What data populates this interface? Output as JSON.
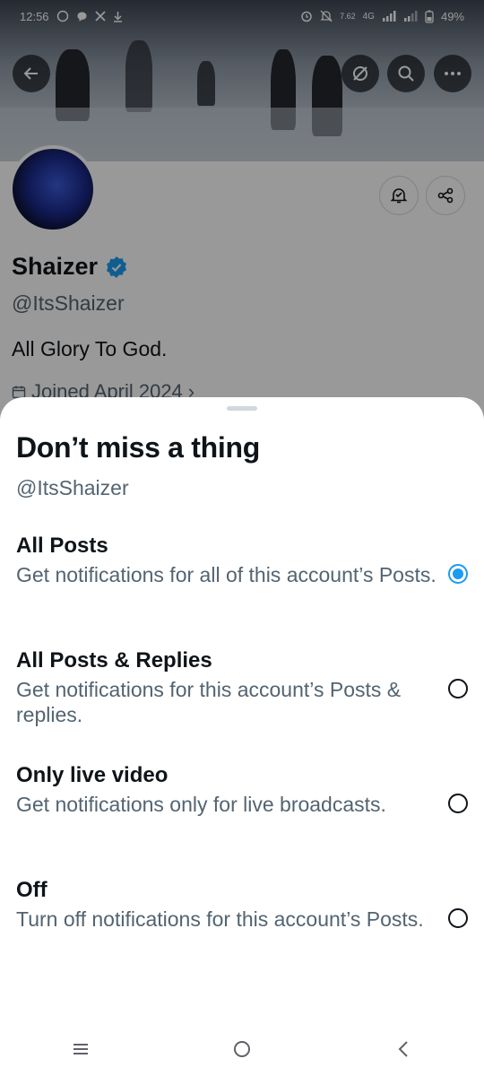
{
  "status_bar": {
    "time": "12:56",
    "left_icons": [
      "whatsapp-icon",
      "chat-icon",
      "x-icon",
      "download-icon"
    ],
    "right_icons": [
      "alarm-icon",
      "mute-icon",
      "data-speed-icon",
      "signal-icon",
      "signal-icon",
      "battery-icon"
    ],
    "network": "4G",
    "speed": "7.62",
    "battery": "49%"
  },
  "profile": {
    "name": "Shaizer",
    "verified": true,
    "handle": "@ItsShaizer",
    "bio": "All Glory To God.",
    "joined": "Joined April 2024",
    "joined_chevron": "›"
  },
  "header_buttons": [
    "back-icon",
    "grok-icon",
    "search-icon",
    "more-icon"
  ],
  "profile_actions": [
    "notification-bell-icon",
    "share-icon"
  ],
  "sheet": {
    "title": "Don’t miss a thing",
    "handle": "@ItsShaizer",
    "options": [
      {
        "title": "All Posts",
        "description": "Get notifications for all of this account’s Posts.",
        "selected": true
      },
      {
        "title": "All Posts & Replies",
        "description": "Get notifications for this account’s Posts & replies.",
        "selected": false
      },
      {
        "title": "Only live video",
        "description": "Get notifications only for live broadcasts.",
        "selected": false
      },
      {
        "title": "Off",
        "description": "Turn off notifications for this account’s Posts.",
        "selected": false
      }
    ]
  },
  "nav_bar": [
    "recents-icon",
    "home-icon",
    "back-icon"
  ],
  "colors": {
    "accent": "#1d9bf0",
    "text": "#0f1419",
    "secondary": "#536471"
  }
}
